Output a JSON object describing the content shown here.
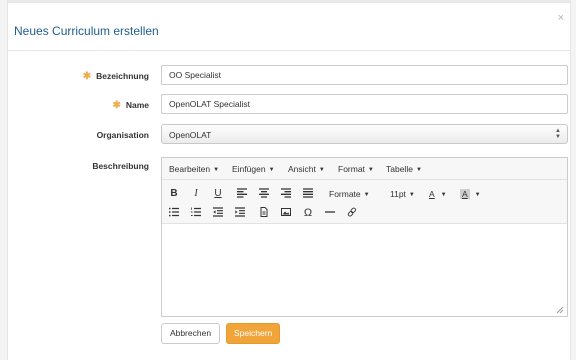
{
  "dialog": {
    "title": "Neues Curriculum erstellen",
    "close_glyph": "×"
  },
  "form": {
    "required_marker": "✱",
    "bezeichnung": {
      "label": "Bezeichnung",
      "value": "OO Specialist",
      "required": true
    },
    "name": {
      "label": "Name",
      "value": "OpenOLAT Specialist",
      "required": true
    },
    "organisation": {
      "label": "Organisation",
      "selected": "OpenOLAT"
    },
    "beschreibung": {
      "label": "Beschreibung",
      "content": ""
    }
  },
  "editor": {
    "menus": [
      {
        "label": "Bearbeiten"
      },
      {
        "label": "Einfügen"
      },
      {
        "label": "Ansicht"
      },
      {
        "label": "Format"
      },
      {
        "label": "Tabelle"
      }
    ],
    "toolbar": {
      "bold": "B",
      "italic": "I",
      "underline": "U",
      "formats_label": "Formate",
      "font_size": "11pt",
      "text_color_glyph": "A",
      "bg_color_glyph": "A",
      "special_char": "Ω"
    }
  },
  "buttons": {
    "cancel": "Abbrechen",
    "save": "Speichern"
  },
  "colors": {
    "title": "#1e5f8e",
    "required": "#f0ad4e",
    "primary_button": "#f0a43a"
  }
}
